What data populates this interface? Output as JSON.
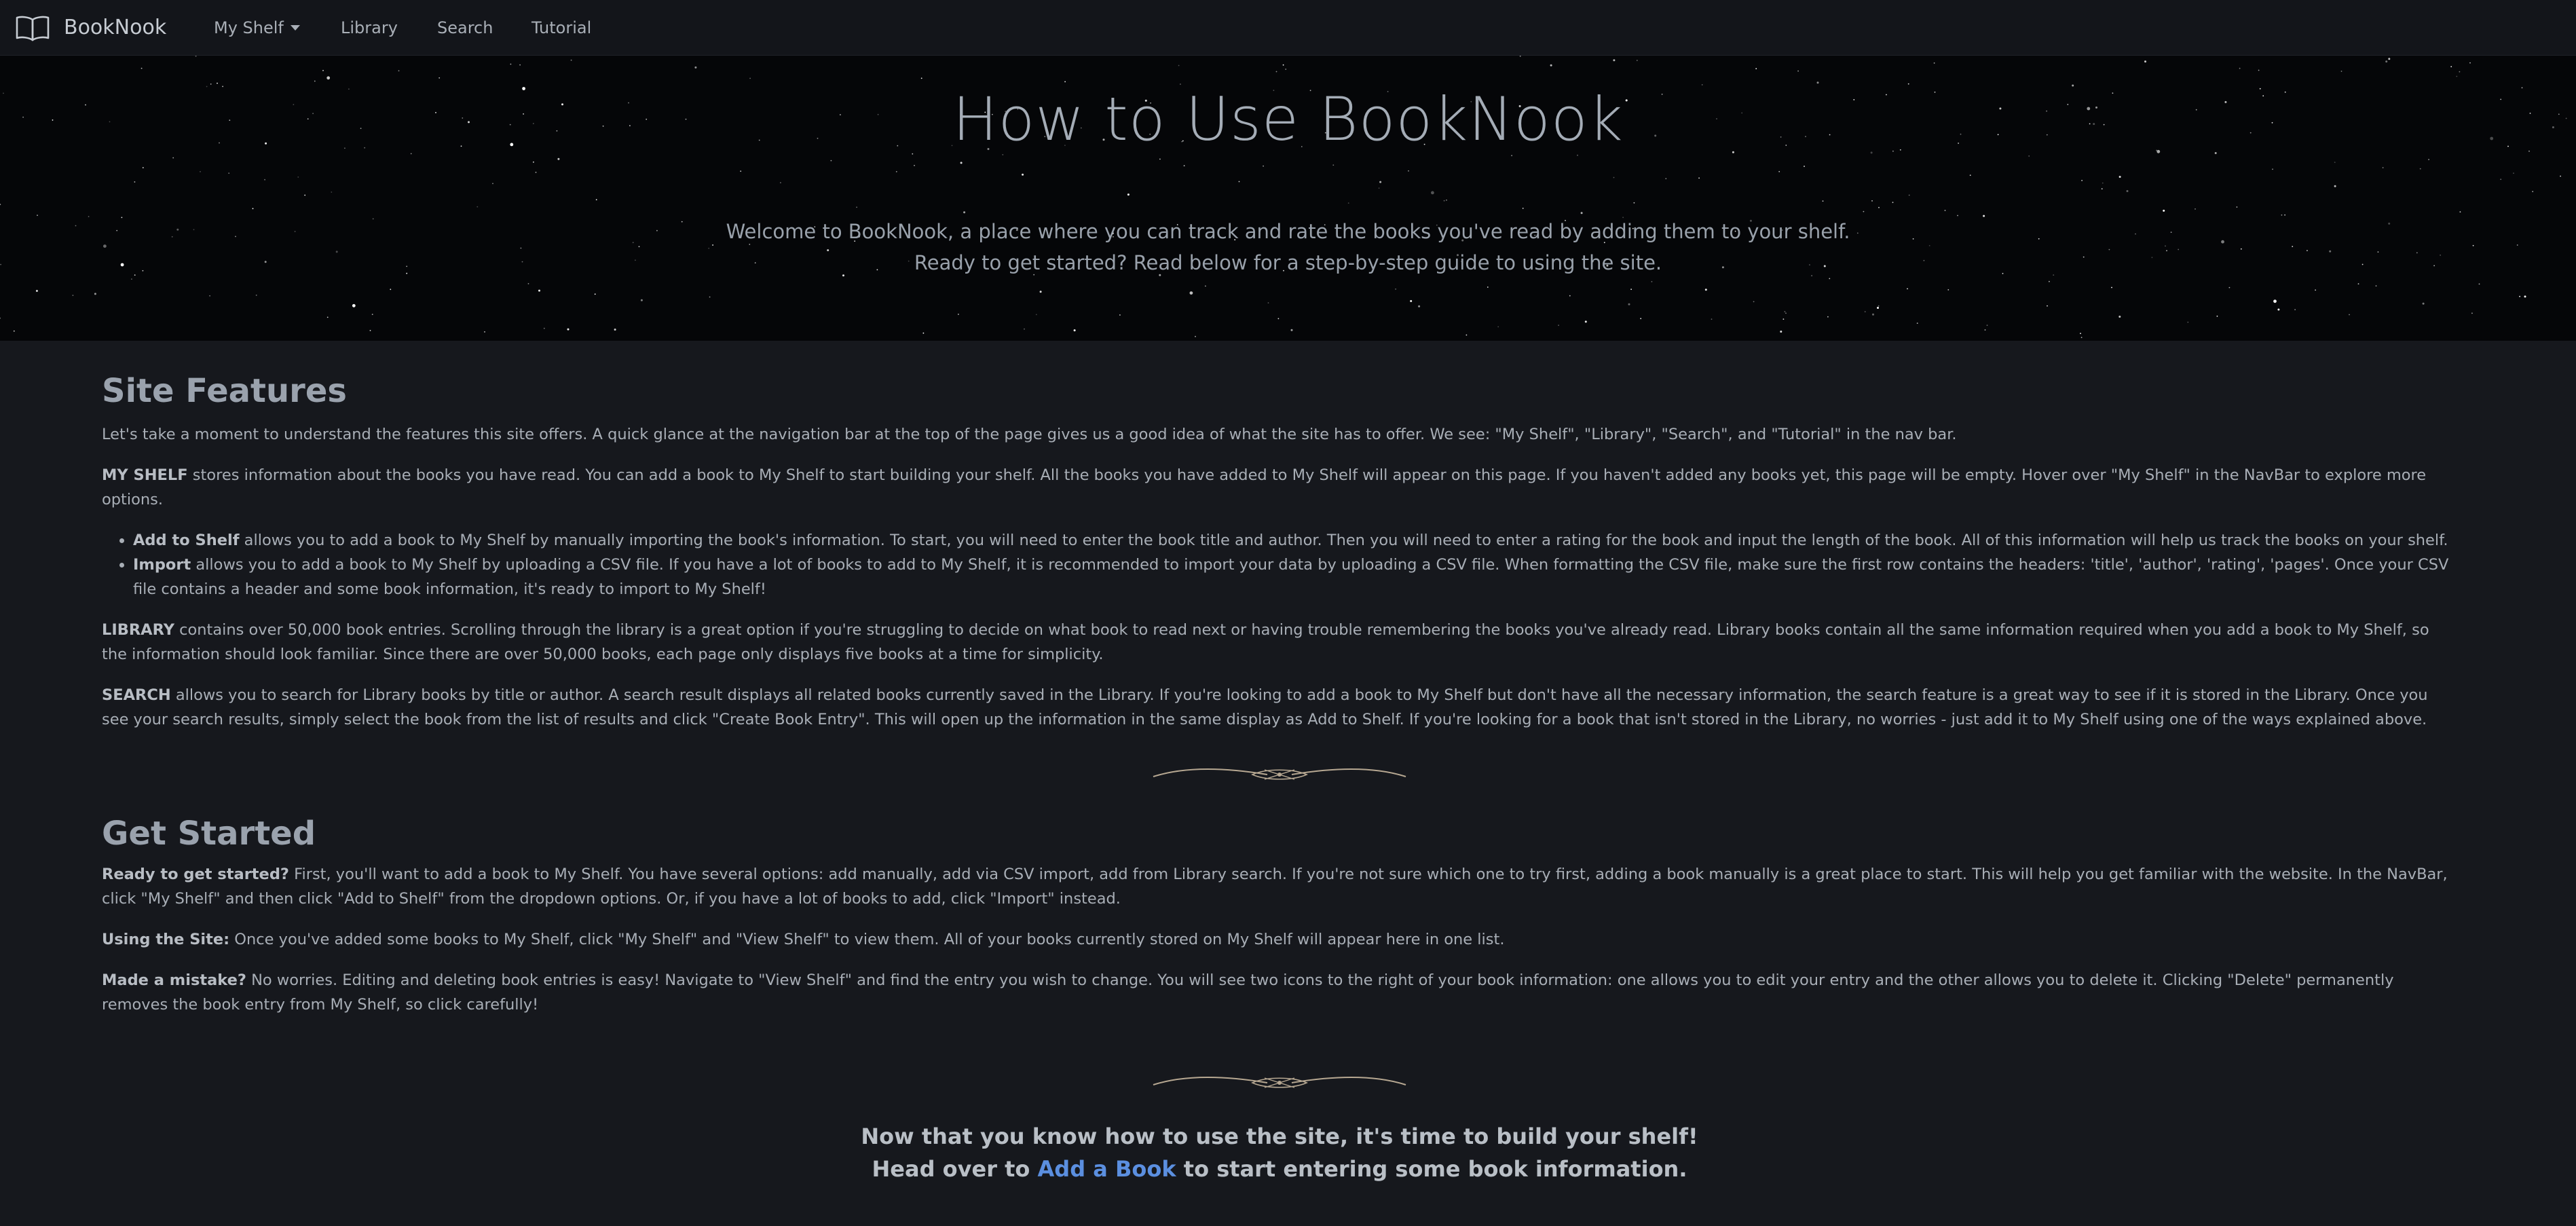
{
  "nav": {
    "brand": "BookNook",
    "my_shelf": "My Shelf",
    "library": "Library",
    "search": "Search",
    "tutorial": "Tutorial"
  },
  "hero": {
    "title": "How to Use BookNook",
    "lead_line1": "Welcome to BookNook, a place where you can track and rate the books you've read by adding them to your shelf.",
    "lead_line2": "Ready to get started? Read below for a step-by-step guide to using the site."
  },
  "site_features": {
    "heading": "Site Features",
    "intro": "Let's take a moment to understand the features this site offers. A quick glance at the navigation bar at the top of the page gives us a good idea of what the site has to offer. We see: \"My Shelf\", \"Library\", \"Search\", and \"Tutorial\" in the nav bar.",
    "my_shelf_label": "MY SHELF",
    "my_shelf_text": " stores information about the books you have read. You can add a book to My Shelf to start building your shelf. All the books you have added to My Shelf will appear on this page. If you haven't added any books yet, this page will be empty. Hover over \"My Shelf\" in the NavBar to explore more options.",
    "add_label": "Add to Shelf",
    "add_text": " allows you to add a book to My Shelf by manually importing the book's information. To start, you will need to enter the book title and author. Then you will need to enter a rating for the book and input the length of the book. All of this information will help us track the books on your shelf.",
    "import_label": "Import",
    "import_text": " allows you to add a book to My Shelf by uploading a CSV file. If you have a lot of books to add to My Shelf, it is recommended to import your data by uploading a CSV file. When formatting the CSV file, make sure the first row contains the headers: 'title', 'author', 'rating', 'pages'. Once your CSV file contains a header and some book information, it's ready to import to My Shelf!",
    "library_label": "LIBRARY",
    "library_text": " contains over 50,000 book entries. Scrolling through the library is a great option if you're struggling to decide on what book to read next or having trouble remembering the books you've already read. Library books contain all the same information required when you add a book to My Shelf, so the information should look familiar. Since there are over 50,000 books, each page only displays five books at a time for simplicity.",
    "search_label": "SEARCH",
    "search_text": " allows you to search for Library books by title or author. A search result displays all related books currently saved in the Library. If you're looking to add a book to My Shelf but don't have all the necessary information, the search feature is a great way to see if it is stored in the Library. Once you see your search results, simply select the book from the list of results and click \"Create Book Entry\". This will open up the information in the same display as Add to Shelf. If you're looking for a book that isn't stored in the Library, no worries - just add it to My Shelf using one of the ways explained above."
  },
  "get_started": {
    "heading": "Get Started",
    "ready_label": "Ready to get started?",
    "ready_text": " First, you'll want to add a book to My Shelf. You have several options: add manually, add via CSV import, add from Library search. If you're not sure which one to try first, adding a book manually is a great place to start. This will help you get familiar with the website. In the NavBar, click \"My Shelf\" and then click \"Add to Shelf\" from the dropdown options. Or, if you have a lot of books to add, click \"Import\" instead.",
    "using_label": "Using the Site:",
    "using_text": " Once you've added some books to My Shelf, click \"My Shelf\" and \"View Shelf\" to view them. All of your books currently stored on My Shelf will appear here in one list.",
    "mistake_label": "Made a mistake?",
    "mistake_text": " No worries. Editing and deleting book entries is easy! Navigate to \"View Shelf\" and find the entry you wish to change. You will see two icons to the right of your book information: one allows you to edit your entry and the other allows you to delete it. Clicking \"Delete\" permanently removes the book entry from My Shelf, so click carefully!"
  },
  "closing": {
    "line1": "Now that you know how to use the site, it's time to build your shelf!",
    "line2_pre": "Head over to ",
    "line2_link": "Add a Book",
    "line2_post": " to start entering some book information."
  }
}
